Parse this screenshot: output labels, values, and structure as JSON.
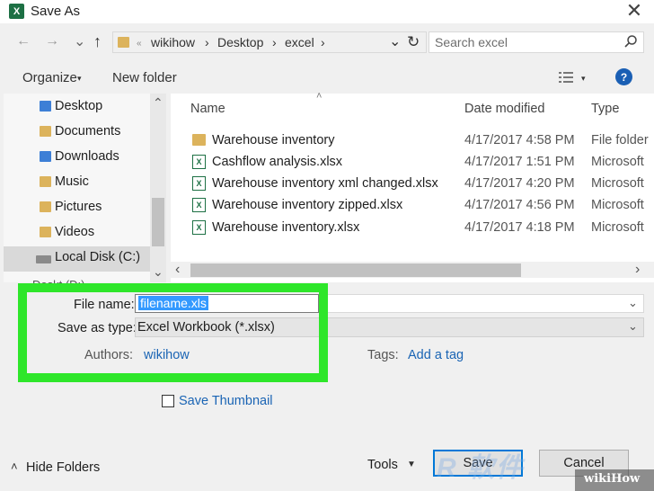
{
  "window": {
    "app_icon_letter": "X",
    "title": "Save As",
    "close_glyph": "✕"
  },
  "address_bar": {
    "back_glyph": "←",
    "forward_glyph": "→",
    "recent_glyph": "⌄",
    "up_glyph": "↑",
    "segments": [
      "wikihow",
      "Desktop",
      "excel"
    ],
    "separator": "›",
    "dropdown_glyph": "⌄",
    "refresh_glyph": "↻"
  },
  "search": {
    "placeholder": "Search excel",
    "icon": "search-icon"
  },
  "toolbar": {
    "organize_label": "Organize",
    "organize_caret": "▾",
    "new_folder_label": "New folder",
    "view_caret": "▾",
    "help_label": "?"
  },
  "nav_pane": {
    "items": [
      {
        "label": "Desktop",
        "icon": "folder-icon"
      },
      {
        "label": "Documents",
        "icon": "folder-icon"
      },
      {
        "label": "Downloads",
        "icon": "download-folder-icon"
      },
      {
        "label": "Music",
        "icon": "folder-icon"
      },
      {
        "label": "Pictures",
        "icon": "folder-icon"
      },
      {
        "label": "Videos",
        "icon": "folder-icon"
      },
      {
        "label": "Local Disk (C:)",
        "icon": "disk-icon",
        "selected": true
      }
    ],
    "scroll_up_glyph": "⌃",
    "scroll_down_glyph": "⌄"
  },
  "file_list": {
    "columns": [
      "Name",
      "Date modified",
      "Type"
    ],
    "sort_glyph": "˄",
    "rows": [
      {
        "name": "Warehouse inventory",
        "date": "4/17/2017 4:58 PM",
        "type": "File folder",
        "icon": "folder-icon"
      },
      {
        "name": "Cashflow analysis.xlsx",
        "date": "4/17/2017 1:51 PM",
        "type": "Microsoft",
        "icon": "excel-file-icon"
      },
      {
        "name": "Warehouse inventory xml changed.xlsx",
        "date": "4/17/2017 4:20 PM",
        "type": "Microsoft",
        "icon": "excel-file-icon"
      },
      {
        "name": "Warehouse inventory zipped.xlsx",
        "date": "4/17/2017 4:56 PM",
        "type": "Microsoft",
        "icon": "excel-file-icon"
      },
      {
        "name": "Warehouse inventory.xlsx",
        "date": "4/17/2017 4:18 PM",
        "type": "Microsoft",
        "icon": "excel-file-icon"
      }
    ],
    "scroll_left_glyph": "‹",
    "scroll_right_glyph": "›"
  },
  "form": {
    "file_name_label": "File name:",
    "file_name_value": "filename.xls",
    "save_as_type_label": "Save as type:",
    "save_as_type_value": "Excel Workbook (*.xlsx)",
    "authors_label": "Authors:",
    "authors_value": "wikihow",
    "tags_label": "Tags:",
    "tags_value": "Add a tag",
    "save_thumbnail_label": "Save Thumbnail",
    "save_thumbnail_checked": false
  },
  "footer": {
    "hide_folders_glyph": "˄",
    "hide_folders_label": "Hide Folders",
    "tools_label": "Tools",
    "tools_caret": "▼",
    "save_label": "Save",
    "cancel_label": "Cancel"
  },
  "badge": {
    "wikihow": "wikiHow"
  },
  "colors": {
    "highlight": "#2ee62a",
    "selection": "#3399ff",
    "link": "#1a64b4",
    "excel": "#1d7044"
  }
}
